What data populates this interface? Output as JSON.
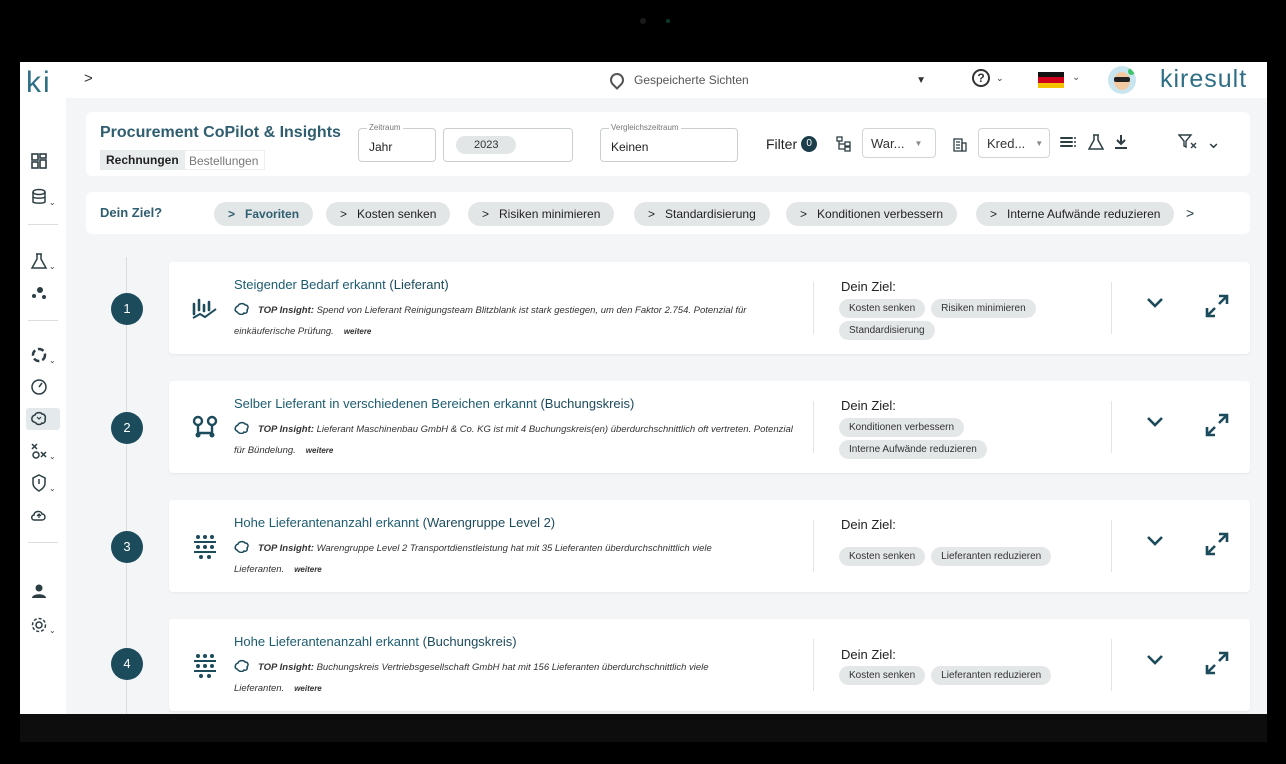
{
  "header": {
    "logo": "ki",
    "collapse_label": ">",
    "saved_views_placeholder": "Gespeicherte Sichten",
    "brand": "kiresult"
  },
  "titlebar": {
    "title": "Procurement CoPilot & Insights",
    "tabs": [
      {
        "label": "Rechnungen",
        "active": true
      },
      {
        "label": "Bestellungen",
        "active": false
      }
    ],
    "zeitraum": {
      "label": "Zeitraum",
      "value": "Jahr",
      "year": "2023"
    },
    "vergleich": {
      "label": "Vergleichszeitraum",
      "value": "Keinen"
    },
    "filter": {
      "label": "Filter",
      "count": "0"
    },
    "select_group": "War...",
    "select_kred": "Kred..."
  },
  "goals": {
    "label": "Dein Ziel?",
    "chips": [
      {
        "label": "Favoriten",
        "chev": ">"
      },
      {
        "label": "Kosten senken",
        "chev": ">"
      },
      {
        "label": "Risiken minimieren",
        "chev": ">"
      },
      {
        "label": "Standardisierung",
        "chev": ">"
      },
      {
        "label": "Konditionen verbessern",
        "chev": ">"
      },
      {
        "label": "Interne Aufwände reduzieren",
        "chev": ">"
      }
    ],
    "more": ">"
  },
  "cards": [
    {
      "number": "1",
      "title": "Steigender Bedarf erkannt",
      "subtitle": "(Lieferant)",
      "top_label": "TOP Insight:",
      "insight": "Spend von Lieferant Reinigungsteam Blitzblank ist stark gestiegen, um den Faktor 2.754. Potenzial für einkäuferische Prüfung.",
      "more": "weitere",
      "goal_title": "Dein Ziel:",
      "tags": [
        "Kosten senken",
        "Risiken minimieren",
        "Standardisierung"
      ]
    },
    {
      "number": "2",
      "title": "Selber Lieferant in verschiedenen Bereichen erkannt",
      "subtitle": "(Buchungskreis)",
      "top_label": "TOP Insight:",
      "insight": "Lieferant Maschinenbau GmbH & Co. KG ist mit 4 Buchungskreis(en) überdurchschnittlich oft vertreten. Potenzial für Bündelung.",
      "more": "weitere",
      "goal_title": "Dein Ziel:",
      "tags": [
        "Konditionen verbessern",
        "Interne Aufwände reduzieren"
      ]
    },
    {
      "number": "3",
      "title": "Hohe Lieferantenanzahl erkannt",
      "subtitle": "(Warengruppe Level 2)",
      "top_label": "TOP Insight:",
      "insight": "Warengruppe Level 2 Transportdienstleistung hat mit 35 Lieferanten überdurchschnittlich viele Lieferanten.",
      "more": "weitere",
      "goal_title": "Dein Ziel:",
      "tags": [
        "Kosten senken",
        "Lieferanten reduzieren"
      ]
    },
    {
      "number": "4",
      "title": "Hohe Lieferantenanzahl erkannt",
      "subtitle": "(Buchungskreis)",
      "top_label": "TOP Insight:",
      "insight": "Buchungskreis Vertriebsgesellschaft GmbH hat mit 156 Lieferanten überdurchschnittlich viele Lieferanten.",
      "more": "weitere",
      "goal_title": "Dein Ziel:",
      "tags": [
        "Kosten senken",
        "Lieferanten reduzieren"
      ]
    }
  ],
  "colors": {
    "accent": "#1c4b5c",
    "brand": "#2f6f86",
    "chip_bg": "#e3e6e7"
  }
}
